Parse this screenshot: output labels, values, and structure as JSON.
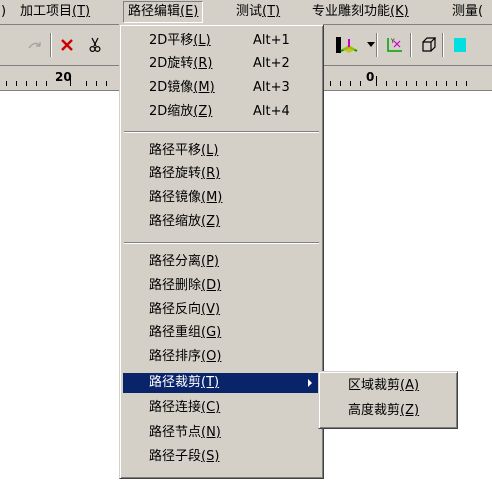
{
  "menubar": {
    "items": [
      {
        "label": "加工项目",
        "key": "(T)"
      },
      {
        "label": "路径编辑",
        "key": "(E)"
      },
      {
        "label": "测试",
        "key": "(T)"
      },
      {
        "label": "专业雕刻功能",
        "key": "(K)"
      },
      {
        "label": "测量(",
        "key": ""
      }
    ]
  },
  "ruler": {
    "labels": [
      "20",
      "0"
    ]
  },
  "dropdown": {
    "group1": [
      {
        "label": "2D平移",
        "key": "(L)",
        "shortcut": "Alt+1"
      },
      {
        "label": "2D旋转",
        "key": "(R)",
        "shortcut": "Alt+2"
      },
      {
        "label": "2D镜像",
        "key": "(M)",
        "shortcut": "Alt+3"
      },
      {
        "label": "2D缩放",
        "key": "(Z)",
        "shortcut": "Alt+4"
      }
    ],
    "group2": [
      {
        "label": "路径平移",
        "key": "(L)"
      },
      {
        "label": "路径旋转",
        "key": "(R)"
      },
      {
        "label": "路径镜像",
        "key": "(M)"
      },
      {
        "label": "路径缩放",
        "key": "(Z)"
      }
    ],
    "group3": [
      {
        "label": "路径分离",
        "key": "(P)"
      },
      {
        "label": "路径删除",
        "key": "(D)"
      },
      {
        "label": "路径反向",
        "key": "(V)"
      },
      {
        "label": "路径重组",
        "key": "(G)"
      },
      {
        "label": "路径排序",
        "key": "(O)"
      },
      {
        "label": "路径裁剪",
        "key": "(T)"
      },
      {
        "label": "路径连接",
        "key": "(C)"
      },
      {
        "label": "路径节点",
        "key": "(N)"
      },
      {
        "label": "路径子段",
        "key": "(S)"
      }
    ]
  },
  "submenu": {
    "items": [
      {
        "label": "区域裁剪",
        "key": "(A)"
      },
      {
        "label": "高度裁剪",
        "key": "(Z)"
      }
    ]
  },
  "colors": {
    "highlight": "#0a246a",
    "face": "#d4d0c8"
  }
}
